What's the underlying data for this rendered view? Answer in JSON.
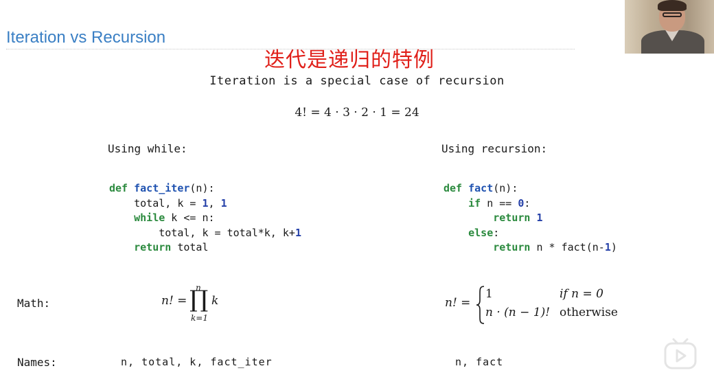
{
  "slide": {
    "title": "Iteration vs Recursion",
    "subtitle_cn": "迭代是递归的特例",
    "heading": "Iteration is a special case of recursion",
    "factorial_example": "4! = 4 · 3 · 2 · 1 = 24"
  },
  "left": {
    "heading": "Using while:",
    "code": {
      "l1_kw": "def",
      "l1_fn": "fact_iter",
      "l1_rest": "(n):",
      "l2_a": "total, k = ",
      "l2_n1": "1",
      "l2_b": ", ",
      "l2_n2": "1",
      "l3_kw": "while",
      "l3_rest": " k <= n:",
      "l4_a": "total, k = total*k, k+",
      "l4_n": "1",
      "l5_kw": "return",
      "l5_rest": " total"
    },
    "math": {
      "lhs": "n! =",
      "op": "∏",
      "upper": "n",
      "lower": "k=1",
      "body": "k"
    },
    "names": "n, total, k, fact_iter"
  },
  "right": {
    "heading": "Using recursion:",
    "code": {
      "l1_kw": "def",
      "l1_fn": "fact",
      "l1_rest": "(n):",
      "l2_kw": "if",
      "l2_rest": " n == ",
      "l2_n": "0",
      "l2_end": ":",
      "l3_kw": "return",
      "l3_sp": " ",
      "l3_n": "1",
      "l4_kw": "else",
      "l4_rest": ":",
      "l5_kw": "return",
      "l5_a": " n * fact(n-",
      "l5_n": "1",
      "l5_b": ")"
    },
    "math": {
      "lhs": "n! =",
      "case1_val": "1",
      "case1_cond": "if n = 0",
      "case2_val": "n · (n − 1)!",
      "case2_cond": "otherwise"
    },
    "names": "n, fact"
  },
  "labels": {
    "math": "Math:",
    "names": "Names:"
  },
  "colors": {
    "title": "#3a7fc4",
    "subtitle_cn": "#e0201a",
    "keyword": "#2b8a3e",
    "function": "#1f52b0",
    "number": "#2540a8"
  },
  "icons": {
    "webcam": "presenter-webcam",
    "player": "bilibili-play-icon"
  }
}
